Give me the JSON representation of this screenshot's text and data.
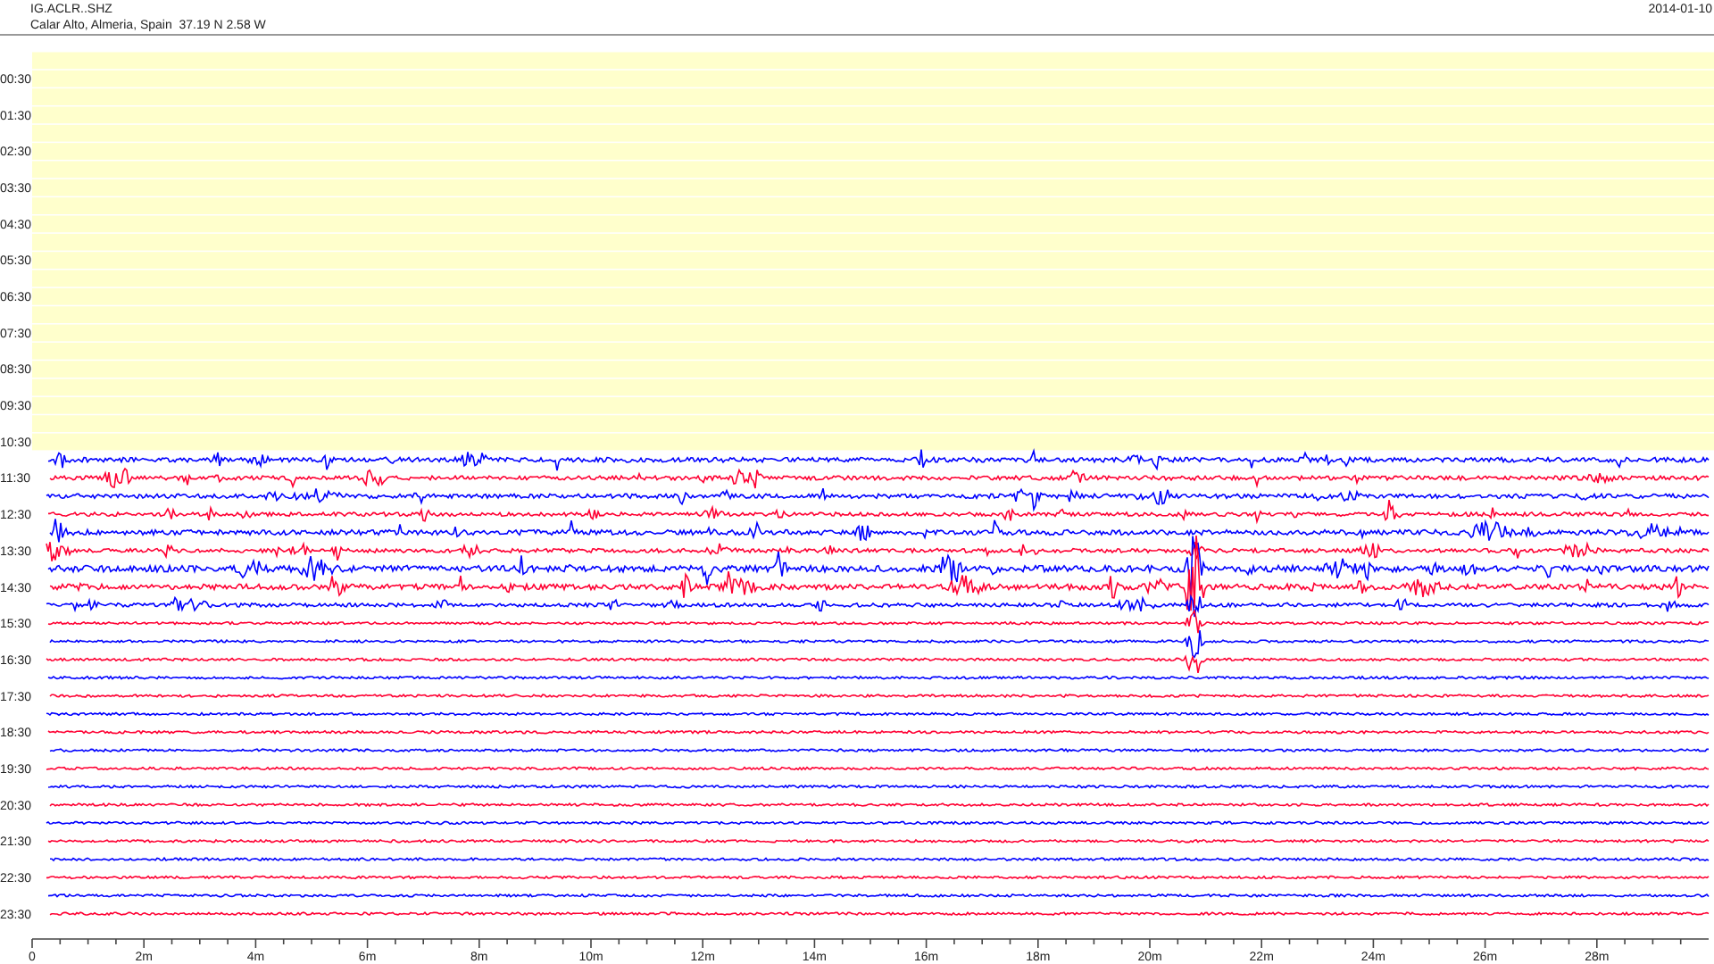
{
  "header": {
    "station": "IG.ACLR..SHZ",
    "location": "Calar Alto, Almeria, Spain  37.19 N 2.58 W",
    "date": "2014-01-10"
  },
  "hour_labels": [
    "00:30",
    "01:30",
    "02:30",
    "03:30",
    "04:30",
    "05:30",
    "06:30",
    "07:30",
    "08:30",
    "09:30",
    "10:30",
    "11:30",
    "12:30",
    "13:30",
    "14:30",
    "15:30",
    "16:30",
    "17:30",
    "18:30",
    "19:30",
    "20:30",
    "21:30",
    "22:30",
    "23:30"
  ],
  "minute_labels": [
    "0",
    "2m",
    "4m",
    "6m",
    "8m",
    "10m",
    "12m",
    "14m",
    "16m",
    "18m",
    "20m",
    "22m",
    "24m",
    "26m",
    "28m"
  ],
  "rows": [
    {
      "kind": "pending"
    },
    {
      "kind": "pending"
    },
    {
      "kind": "pending"
    },
    {
      "kind": "pending"
    },
    {
      "kind": "pending"
    },
    {
      "kind": "pending"
    },
    {
      "kind": "pending"
    },
    {
      "kind": "pending"
    },
    {
      "kind": "pending"
    },
    {
      "kind": "pending"
    },
    {
      "kind": "pending"
    },
    {
      "kind": "pending"
    },
    {
      "kind": "pending"
    },
    {
      "kind": "pending"
    },
    {
      "kind": "pending"
    },
    {
      "kind": "pending"
    },
    {
      "kind": "pending"
    },
    {
      "kind": "pending"
    },
    {
      "kind": "pending"
    },
    {
      "kind": "pending"
    },
    {
      "kind": "pending"
    },
    {
      "kind": "pending"
    },
    {
      "kind": "trace",
      "color": "#0000ff"
    },
    {
      "kind": "trace",
      "color": "#ff0033"
    },
    {
      "kind": "trace",
      "color": "#0000ff"
    },
    {
      "kind": "trace",
      "color": "#ff0033"
    },
    {
      "kind": "trace",
      "color": "#0000ff"
    },
    {
      "kind": "trace",
      "color": "#ff0033"
    },
    {
      "kind": "trace",
      "color": "#0000ff"
    },
    {
      "kind": "trace",
      "color": "#ff0033"
    },
    {
      "kind": "trace",
      "color": "#0000ff"
    },
    {
      "kind": "trace",
      "color": "#ff0033"
    },
    {
      "kind": "trace",
      "color": "#0000ff"
    },
    {
      "kind": "trace",
      "color": "#ff0033"
    },
    {
      "kind": "trace",
      "color": "#0000ff"
    },
    {
      "kind": "trace",
      "color": "#ff0033"
    },
    {
      "kind": "trace",
      "color": "#0000ff"
    },
    {
      "kind": "trace",
      "color": "#ff0033"
    },
    {
      "kind": "trace",
      "color": "#0000ff"
    },
    {
      "kind": "trace",
      "color": "#ff0033"
    },
    {
      "kind": "trace",
      "color": "#0000ff"
    },
    {
      "kind": "trace",
      "color": "#ff0033"
    },
    {
      "kind": "trace",
      "color": "#0000ff"
    },
    {
      "kind": "trace",
      "color": "#ff0033"
    },
    {
      "kind": "trace",
      "color": "#0000ff"
    },
    {
      "kind": "trace",
      "color": "#ff0033"
    },
    {
      "kind": "trace",
      "color": "#0000ff"
    },
    {
      "kind": "trace",
      "color": "#ff0033"
    }
  ]
}
